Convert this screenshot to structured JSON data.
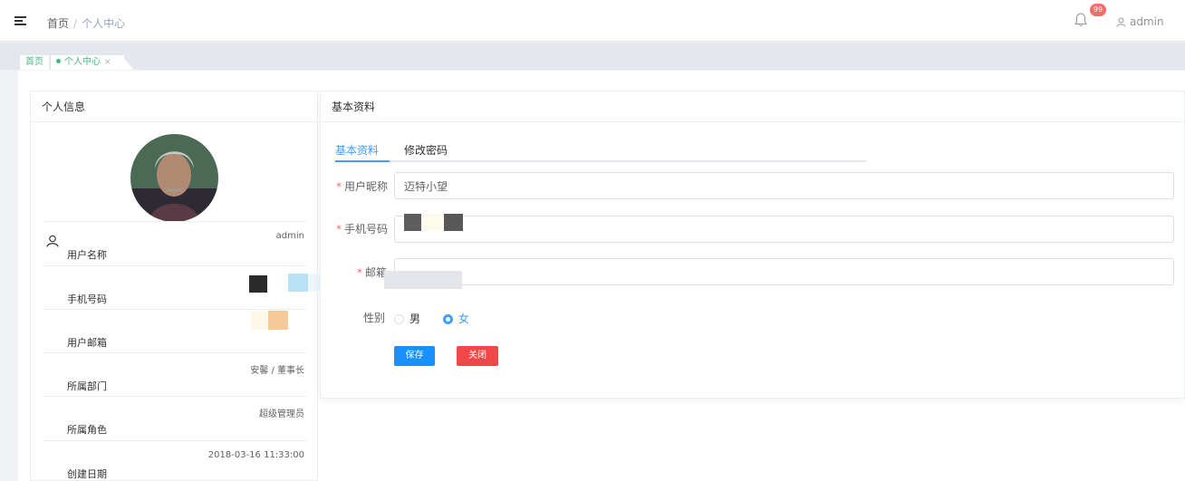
{
  "navbar": {
    "breadcrumb": [
      "首页",
      "个人中心"
    ],
    "breadcrumb_sep": "/",
    "notification_count": "99",
    "user_name": "admin"
  },
  "tags": {
    "home": "首页",
    "active": "个人中心",
    "close": "×"
  },
  "profile_card": {
    "title": "个人信息",
    "rows": [
      {
        "label": "用户名称",
        "value": "admin"
      },
      {
        "label": "手机号码",
        "value": ""
      },
      {
        "label": "用户邮箱",
        "value": ""
      },
      {
        "label": "所属部门",
        "value": "安馨 / 董事长"
      },
      {
        "label": "所属角色",
        "value": "超级管理员"
      },
      {
        "label": "创建日期",
        "value": "2018-03-16 11:33:00"
      }
    ]
  },
  "basic_card": {
    "title": "基本资料",
    "tabs": [
      "基本资料",
      "修改密码"
    ],
    "form": {
      "nickname_label": "用户昵称",
      "nickname_value": "迈特小望",
      "phone_label": "手机号码",
      "email_label": "邮箱",
      "gender_label": "性别",
      "gender_options": [
        "男",
        "女"
      ],
      "gender_selected": "女",
      "required_mark": "*"
    },
    "buttons": {
      "save": "保存",
      "close": "关闭"
    }
  },
  "colors": {
    "primary": "#409eff",
    "danger": "#f04848",
    "tag_green": "#42b983",
    "badge": "#f56c6c"
  }
}
